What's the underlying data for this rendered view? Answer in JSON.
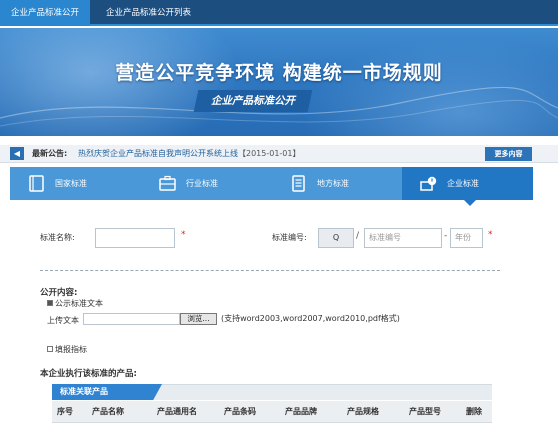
{
  "topnav": {
    "tabs": [
      {
        "label": "企业产品标准公开"
      },
      {
        "label": "企业产品标准公开列表"
      }
    ]
  },
  "banner": {
    "headline": "营造公平竞争环境 构建统一市场规则",
    "subtitle": "企业产品标准公开"
  },
  "notice": {
    "label": "最新公告:",
    "message": "热烈庆贺企业产品标准自我声明公开系统上线",
    "date": "【2015-01-01】",
    "more": "更多内容"
  },
  "categories": [
    {
      "label": "国家标准",
      "icon": "book-icon"
    },
    {
      "label": "行业标准",
      "icon": "briefcase-icon"
    },
    {
      "label": "地方标准",
      "icon": "document-icon"
    },
    {
      "label": "企业标准",
      "icon": "enterprise-icon"
    }
  ],
  "form": {
    "name_label": "标准名称:",
    "name_value": "",
    "number_label": "标准编号:",
    "number_prefix": "Q",
    "number_sep": "/",
    "number_placeholder": "标准编号",
    "number_dash": "-",
    "year_placeholder": "年份",
    "required_mark": "*"
  },
  "disclosure": {
    "title": "公开内容:",
    "public_text_label": "公示标准文本",
    "upload_label": "上传文本",
    "upload_value": "",
    "browse_label": "浏览...",
    "format_note": "(支持word2003,word2007,word2010,pdf格式)",
    "fill_indicator_label": "填报指标"
  },
  "products": {
    "title": "本企业执行该标准的产品:",
    "tab_label": "标准关联产品",
    "columns": [
      "序号",
      "产品名称",
      "产品通用名",
      "产品条码",
      "产品品牌",
      "产品规格",
      "产品型号",
      "删除"
    ]
  },
  "colors": {
    "nav_bg": "#1c4f80",
    "accent": "#2a86cf",
    "category_bar": "#4a98d8",
    "category_active": "#2277c4",
    "required": "#d9262c"
  }
}
